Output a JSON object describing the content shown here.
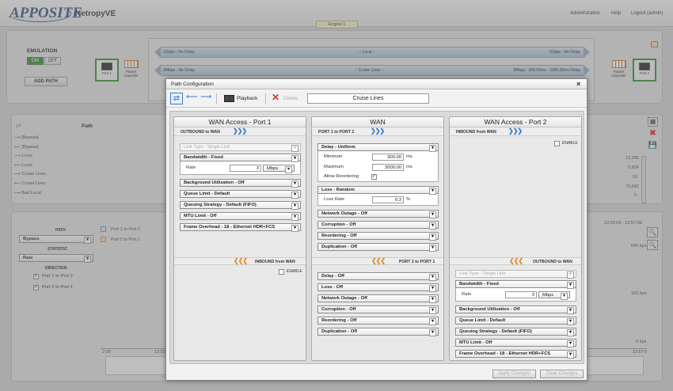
{
  "header": {
    "logo": "APPOSITE",
    "product": "NetropyVE",
    "links": [
      "Administration",
      "Help",
      "Logout (admin)"
    ],
    "engine": "Engine 1"
  },
  "emulation": {
    "title": "EMULATION",
    "on": "ON",
    "off": "OFF",
    "add_path": "ADD PATH"
  },
  "ports": {
    "port1": "Port 1",
    "port2": "Port 2",
    "classifier": "Packet Classifier"
  },
  "lanes": [
    {
      "left": "1Gbps - No Delay",
      "center": "-- Local --",
      "right": "1Gbps - No Delay"
    },
    {
      "left": "3Mbps - No Delay",
      "center": "-- Cruise Lines --",
      "right": "3Mbps - 900.00ms - 3000.00ms Delay"
    }
  ],
  "paths_table": {
    "header": "Path",
    "rows": [
      "[Bypass]",
      "[Bypass]",
      "Local",
      "Local",
      "Cruise Lines",
      "Cruise Lines",
      "Bad Local"
    ],
    "right_values": [
      "12,305",
      "5,824",
      "53",
      "79,542",
      "0"
    ]
  },
  "stats": {
    "path_label": "PATH",
    "path_value": "Bypass",
    "statistic_label": "STATISTIC",
    "statistic_value": "Rate",
    "direction_label": "DIRECTION",
    "dir1": "Port 1 to Port 2",
    "dir2": "Port 2 to Port 1",
    "legend1": "Port 1 to Port 2",
    "legend2": "Port 2 to Port 1",
    "time_range": "13:52:09 - 13:57:09",
    "y1": "640 bps",
    "y2": "320 bps",
    "y3": "0 bps",
    "x_left": "2:09",
    "x_mid": "13:52",
    "x_right": "13:57:0"
  },
  "dialog": {
    "title": "Path Configuration",
    "close": "×",
    "playback": "Playback",
    "delete": "Delete",
    "path_name": "Cruise Lines",
    "apply": "Apply Changes",
    "clear": "Clear Changes",
    "port1": {
      "title": "WAN Access - Port 1",
      "outbound": "OUTBOUND to WAN",
      "link_type": "Link Type - Single Link",
      "bandwidth": "Bandwidth - Fixed",
      "rate_label": "Rate",
      "rate_value": "3",
      "rate_unit": "Mbps",
      "items": [
        "Background Utilization - Off",
        "Queue Limit - Default",
        "Queuing Strategy - Default (FIFO)",
        "MTU Limit - Off",
        "Frame Overhead - 18 - Ethernet HDR+FCS"
      ],
      "inbound": "INBOUND from WAN",
      "enable": "ENABLE"
    },
    "wan": {
      "title": "WAN",
      "dir1": "PORT 1 to PORT 2",
      "delay": "Delay - Uniform",
      "min_label": "Minimum",
      "min_value": "900.00",
      "max_label": "Maximum",
      "max_value": "3000.00",
      "ms": "ms",
      "allow_reorder": "Allow Reordering",
      "loss": "Loss - Random",
      "loss_rate_label": "Loss Rate",
      "loss_rate_value": "0.3",
      "pct": "%",
      "items1": [
        "Network Outage - Off",
        "Corruption - Off",
        "Reordering - Off",
        "Duplication - Off"
      ],
      "dir2": "PORT 2 to PORT 1",
      "items2": [
        "Delay - Off",
        "Loss - Off",
        "Network Outage - Off",
        "Corruption - Off",
        "Reordering - Off",
        "Duplication - Off"
      ]
    },
    "port2": {
      "title": "WAN Access - Port 2",
      "inbound": "INBOUND from WAN",
      "enable": "ENABLE",
      "outbound": "OUTBOUND to WAN",
      "link_type": "Link Type - Single Link",
      "bandwidth": "Bandwidth - Fixed",
      "rate_label": "Rate",
      "rate_value": "3",
      "rate_unit": "Mbps",
      "items": [
        "Background Utilization - Off",
        "Queue Limit - Default",
        "Queuing Strategy - Default (FIFO)",
        "MTU Limit - Off",
        "Frame Overhead - 18 - Ethernet HDR+FCS"
      ]
    }
  }
}
